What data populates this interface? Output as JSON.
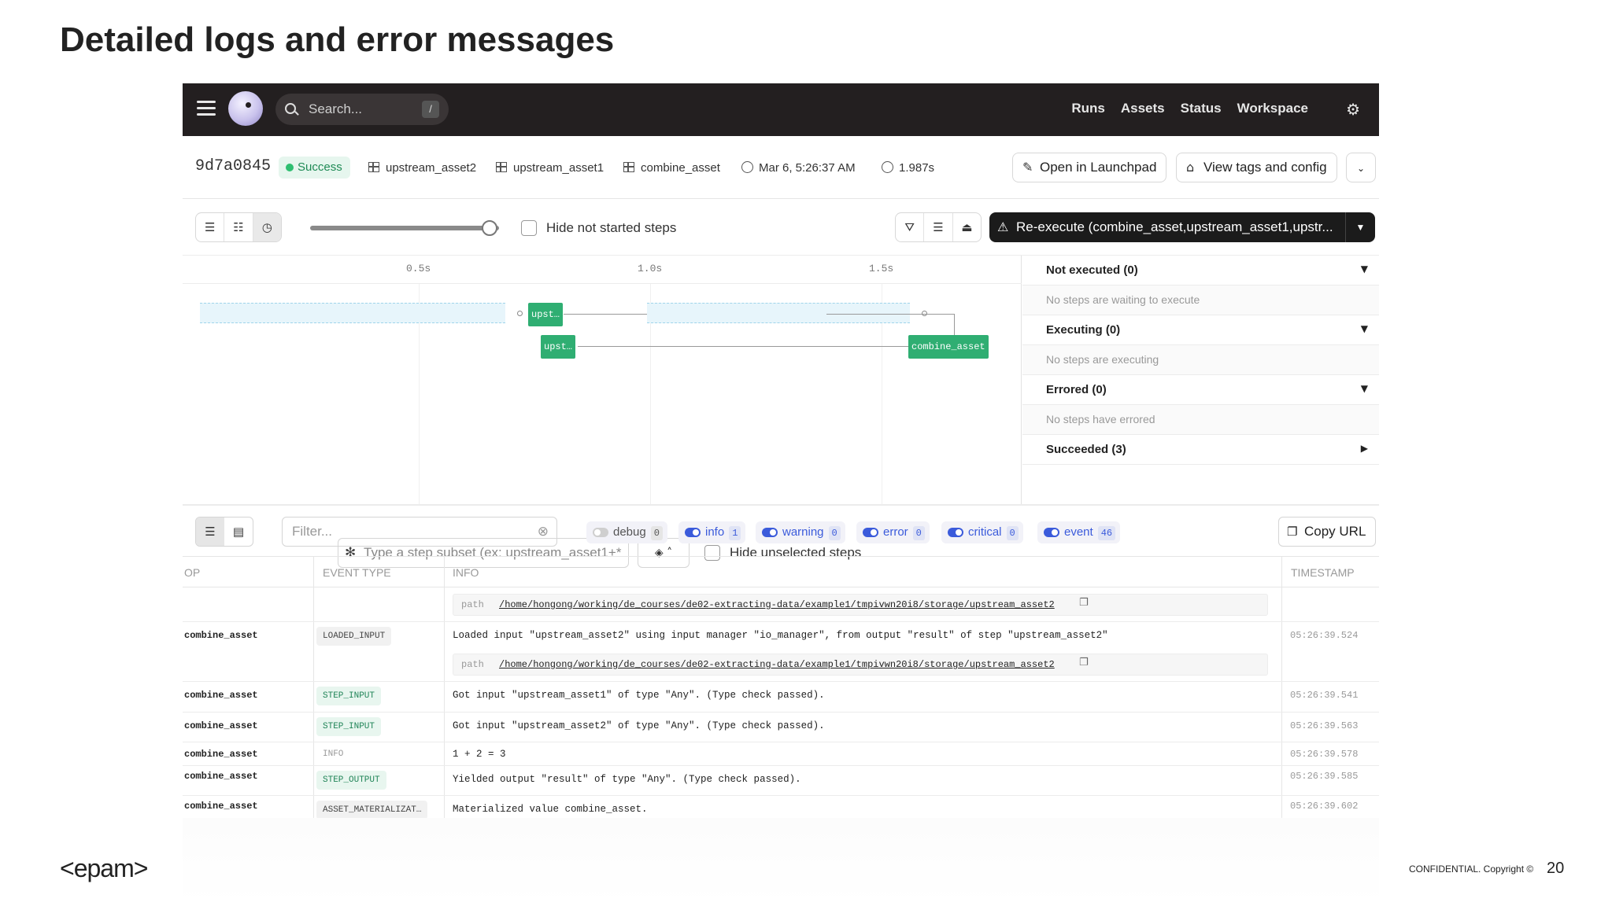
{
  "slide": {
    "title": "Detailed logs and error messages",
    "footer_logo": "<epam>",
    "confidential": "CONFIDENTIAL. Copyright ©",
    "page_number": "20"
  },
  "nav": {
    "search_placeholder": "Search...",
    "search_shortcut": "/",
    "links": [
      "Runs",
      "Assets",
      "Status",
      "Workspace"
    ]
  },
  "run": {
    "id": "9d7a0845",
    "status": "Success",
    "assets": [
      "upstream_asset2",
      "upstream_asset1",
      "combine_asset"
    ],
    "started": "Mar 6, 5:26:37 AM",
    "duration": "1.987s",
    "open_launchpad": "Open in Launchpad",
    "view_tags": "View tags and config"
  },
  "toolbar": {
    "hide_not_started": "Hide not started steps",
    "reexecute": "Re-execute (combine_asset,upstream_asset1,upstr...",
    "zoom_slider_fraction": 0.95
  },
  "gantt": {
    "ticks": [
      "0.5s",
      "1.0s",
      "1.5s"
    ],
    "box_upstream_a": "upst…",
    "box_upstream_b": "upst…",
    "box_combine": "combine_asset",
    "subset_placeholder": "Type a step subset (ex: upstream_asset1+*",
    "hide_unselected": "Hide unselected steps"
  },
  "status_panel": {
    "not_executed": "Not executed (0)",
    "not_executed_msg": "No steps are waiting to execute",
    "executing": "Executing (0)",
    "executing_msg": "No steps are executing",
    "errored": "Errored (0)",
    "errored_msg": "No steps have errored",
    "succeeded": "Succeeded (3)"
  },
  "logs_toolbar": {
    "filter_placeholder": "Filter...",
    "levels": [
      {
        "name": "debug",
        "count": "0",
        "enabled": false
      },
      {
        "name": "info",
        "count": "1",
        "enabled": true
      },
      {
        "name": "warning",
        "count": "0",
        "enabled": true
      },
      {
        "name": "error",
        "count": "0",
        "enabled": true
      },
      {
        "name": "critical",
        "count": "0",
        "enabled": true
      },
      {
        "name": "event",
        "count": "46",
        "enabled": true
      }
    ],
    "copy_url": "Copy URL"
  },
  "table": {
    "headers": [
      "OP",
      "EVENT TYPE",
      "INFO",
      "TIMESTAMP"
    ],
    "path_key": "path",
    "path_value": "/home/hongong/working/de_courses/de02-extracting-data/example1/tmpivwn20i8/storage/upstream_asset2",
    "rows": [
      {
        "op": "combine_asset",
        "event": "LOADED_INPUT",
        "info": "Loaded input \"upstream_asset2\" using input manager \"io_manager\", from output \"result\" of step \"upstream_asset2\"",
        "ts": "05:26:39.524"
      },
      {
        "op": "combine_asset",
        "event": "STEP_INPUT",
        "info": "Got input \"upstream_asset1\" of type \"Any\". (Type check passed).",
        "ts": "05:26:39.541"
      },
      {
        "op": "combine_asset",
        "event": "STEP_INPUT",
        "info": "Got input \"upstream_asset2\" of type \"Any\". (Type check passed).",
        "ts": "05:26:39.563"
      },
      {
        "op": "combine_asset",
        "event": "INFO",
        "info": "1 + 2 = 3",
        "ts": "05:26:39.578"
      },
      {
        "op": "combine_asset",
        "event": "STEP_OUTPUT",
        "info": "Yielded output \"result\" of type \"Any\". (Type check passed).",
        "ts": "05:26:39.585"
      },
      {
        "op": "combine_asset",
        "event": "ASSET_MATERIALIZAT…",
        "info": "Materialized value combine_asset.",
        "ts": "05:26:39.602"
      }
    ]
  }
}
